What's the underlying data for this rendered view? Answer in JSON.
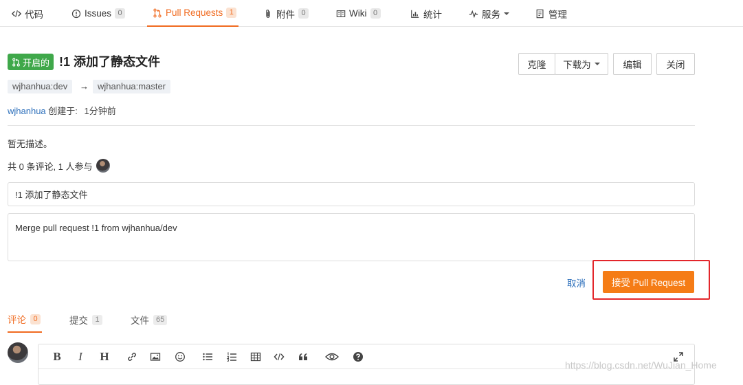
{
  "nav": {
    "tabs": [
      {
        "label": "代码",
        "count": null,
        "icon": "code-icon"
      },
      {
        "label": "Issues",
        "count": "0",
        "icon": "issue-icon"
      },
      {
        "label": "Pull Requests",
        "count": "1",
        "icon": "pull-request-icon",
        "active": true
      },
      {
        "label": "附件",
        "count": "0",
        "icon": "paperclip-icon"
      },
      {
        "label": "Wiki",
        "count": "0",
        "icon": "book-icon"
      },
      {
        "label": "统计",
        "count": null,
        "icon": "bar-chart-icon"
      },
      {
        "label": "服务",
        "count": null,
        "icon": "pulse-icon",
        "dropdown": true
      },
      {
        "label": "管理",
        "count": null,
        "icon": "settings-doc-icon"
      }
    ]
  },
  "pr": {
    "status": "开启的",
    "title": "!1 添加了静态文件",
    "source_branch": "wjhanhua:dev",
    "arrow": "→",
    "target_branch": "wjhanhua:master",
    "author": "wjhanhua",
    "created_label": "创建于:",
    "created_time": "1分钟前",
    "description": "暂无描述。",
    "stats": "共 0 条评论, 1 人参与"
  },
  "actions": {
    "clone": "克隆",
    "download": "下载为",
    "edit": "编辑",
    "close": "关闭"
  },
  "merge": {
    "title_value": "!1 添加了静态文件",
    "message_value": "Merge pull request !1 from wjhanhua/dev",
    "cancel": "取消",
    "accept": "接受 Pull Request"
  },
  "subtabs": [
    {
      "label": "评论",
      "count": "0",
      "active": true
    },
    {
      "label": "提交",
      "count": "1"
    },
    {
      "label": "文件",
      "count": "65"
    }
  ],
  "editor": {
    "bold": "B",
    "italic": "I",
    "heading": "H"
  },
  "watermark": "https://blog.csdn.net/WuJian_Home",
  "colors": {
    "accent": "#f06a1f",
    "accept_button": "#f57c16",
    "open_badge": "#3fa84a",
    "link": "#2c6fbb",
    "highlight": "#e3262b"
  }
}
